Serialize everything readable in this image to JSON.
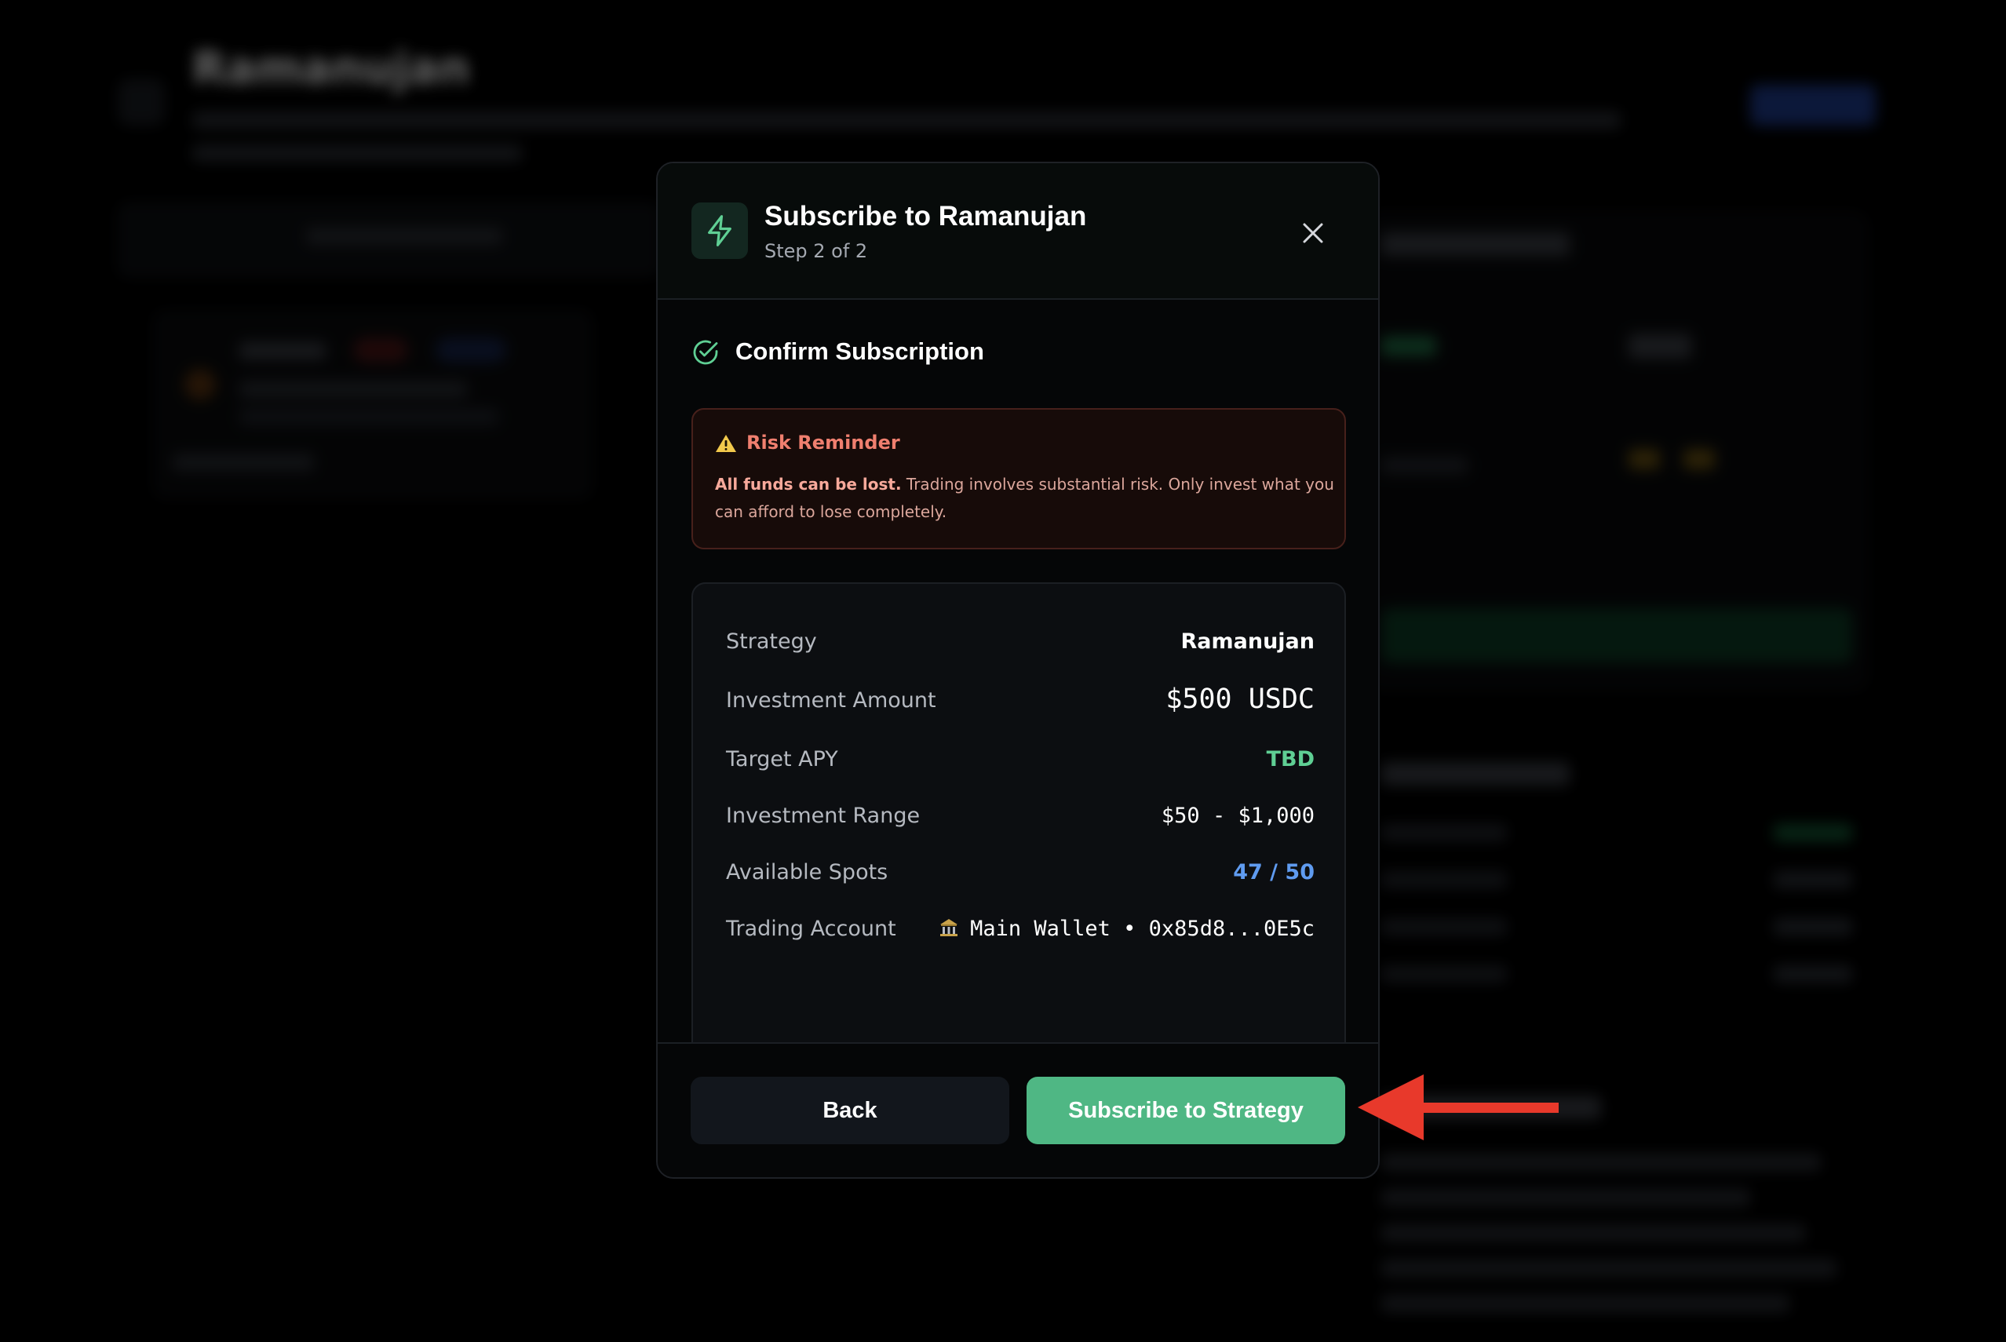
{
  "background": {
    "page_title": "Ramanujan"
  },
  "modal": {
    "title": "Subscribe to Ramanujan",
    "step": "Step 2 of 2",
    "header_icon": "lightning-icon",
    "close_icon": "close-icon",
    "section_title": "Confirm Subscription",
    "section_icon": "check-circle-icon",
    "risk": {
      "icon": "warning-triangle-icon",
      "title": "Risk Reminder",
      "text_bold": "All funds can be lost.",
      "text": " Trading involves substantial risk. Only invest what you can afford to lose completely."
    },
    "details": [
      {
        "label": "Strategy",
        "value": "Ramanujan"
      },
      {
        "label": "Investment Amount",
        "value": "$500 USDC"
      },
      {
        "label": "Target APY",
        "value": "TBD"
      },
      {
        "label": "Investment Range",
        "value": "$50 - $1,000"
      },
      {
        "label": "Available Spots",
        "value": "47 / 50"
      },
      {
        "label": "Trading Account",
        "value": "Main Wallet • 0x85d8...0E5c",
        "icon": "bank-icon"
      }
    ],
    "buttons": {
      "back": "Back",
      "subscribe": "Subscribe to Strategy"
    }
  },
  "colors": {
    "accent_green": "#4fb784",
    "risk_red": "#f07f6f",
    "spots_blue": "#5f9bf0",
    "annotation_arrow": "#e8392b"
  }
}
